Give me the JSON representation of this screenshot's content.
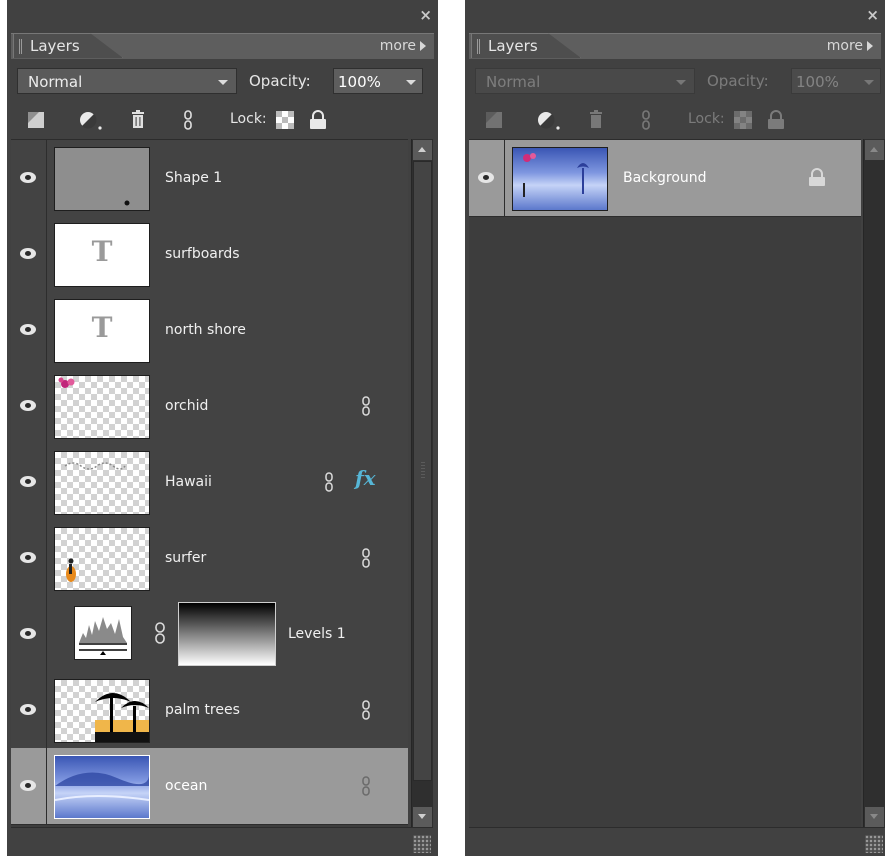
{
  "left_panel": {
    "close_label": "×",
    "tab_label": "Layers",
    "more_label": "more",
    "blend_mode": "Normal",
    "opacity_label": "Opacity:",
    "opacity_value": "100%",
    "lock_label": "Lock:",
    "layers": [
      {
        "name": "Shape 1",
        "kind": "shape",
        "linked": false,
        "fx": false,
        "selected": false
      },
      {
        "name": "surfboards",
        "kind": "text",
        "thumb_glyph": "T",
        "linked": false,
        "fx": false,
        "selected": false
      },
      {
        "name": "north shore",
        "kind": "text",
        "thumb_glyph": "T",
        "linked": false,
        "fx": false,
        "selected": false
      },
      {
        "name": "orchid",
        "kind": "image",
        "linked": true,
        "fx": false,
        "selected": false
      },
      {
        "name": "Hawaii",
        "kind": "image",
        "linked": true,
        "fx": true,
        "fx_label": "fx",
        "selected": false
      },
      {
        "name": "surfer",
        "kind": "image",
        "linked": true,
        "fx": false,
        "selected": false
      },
      {
        "name": "Levels 1",
        "kind": "adjustment",
        "linked": true,
        "fx": false,
        "selected": false
      },
      {
        "name": "palm trees",
        "kind": "image",
        "linked": true,
        "fx": false,
        "selected": false
      },
      {
        "name": "ocean",
        "kind": "image",
        "linked": true,
        "fx": false,
        "selected": true
      }
    ]
  },
  "right_panel": {
    "close_label": "×",
    "tab_label": "Layers",
    "more_label": "more",
    "blend_mode": "Normal",
    "opacity_label": "Opacity:",
    "opacity_value": "100%",
    "lock_label": "Lock:",
    "layers": [
      {
        "name": "Background",
        "kind": "image",
        "locked": true,
        "selected": true
      }
    ]
  },
  "colors": {
    "panel_bg": "#414141",
    "row_bg": "#434343",
    "selected_row_bg": "#9a9a9a",
    "fx_accent": "#56b6d6",
    "text": "#f0f0f0"
  },
  "icons": [
    "close-icon",
    "grip-icon",
    "menu-arrow-icon",
    "new-layer-icon",
    "adjustment-layer-icon",
    "trash-icon",
    "link-icon",
    "lock-transparency-icon",
    "lock-all-icon",
    "eye-icon",
    "layer-link-icon",
    "fx-icon",
    "scroll-up-icon",
    "scroll-down-icon",
    "resize-grip-icon",
    "lock-icon"
  ]
}
